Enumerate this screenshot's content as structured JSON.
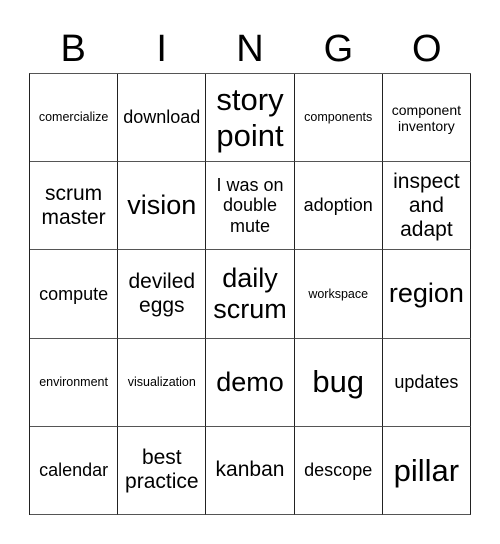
{
  "header": [
    "B",
    "I",
    "N",
    "G",
    "O"
  ],
  "cells": [
    [
      {
        "text": "comercialize",
        "size": "xs"
      },
      {
        "text": "download",
        "size": "md"
      },
      {
        "text": "story point",
        "size": "xxl"
      },
      {
        "text": "components",
        "size": "xs"
      },
      {
        "text": "component inventory",
        "size": "sm"
      }
    ],
    [
      {
        "text": "scrum master",
        "size": "lg"
      },
      {
        "text": "vision",
        "size": "xl"
      },
      {
        "text": "I was on double mute",
        "size": "md"
      },
      {
        "text": "adoption",
        "size": "md"
      },
      {
        "text": "inspect and adapt",
        "size": "lg"
      }
    ],
    [
      {
        "text": "compute",
        "size": "md"
      },
      {
        "text": "deviled eggs",
        "size": "lg"
      },
      {
        "text": "daily scrum",
        "size": "xl"
      },
      {
        "text": "workspace",
        "size": "xs"
      },
      {
        "text": "region",
        "size": "xl"
      }
    ],
    [
      {
        "text": "environment",
        "size": "xs"
      },
      {
        "text": "visualization",
        "size": "xs"
      },
      {
        "text": "demo",
        "size": "xl"
      },
      {
        "text": "bug",
        "size": "xxl"
      },
      {
        "text": "updates",
        "size": "md"
      }
    ],
    [
      {
        "text": "calendar",
        "size": "md"
      },
      {
        "text": "best practice",
        "size": "lg"
      },
      {
        "text": "kanban",
        "size": "lg"
      },
      {
        "text": "descope",
        "size": "md"
      },
      {
        "text": "pillar",
        "size": "xxl"
      }
    ]
  ]
}
